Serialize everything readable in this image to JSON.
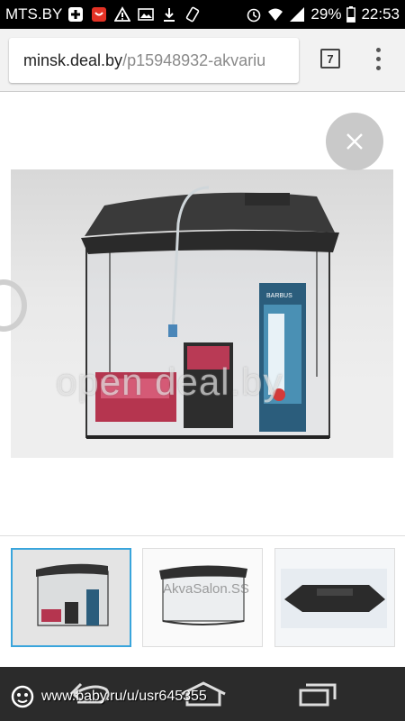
{
  "status_bar": {
    "carrier": "MTS.BY",
    "battery": "29%",
    "time": "22:53",
    "icons": [
      "plus-icon",
      "aliexpress-icon",
      "warning-icon",
      "image-icon",
      "download-icon",
      "vibrate-icon",
      "alarm-icon",
      "wifi-icon",
      "signal-icon",
      "battery-icon"
    ]
  },
  "browser": {
    "url_host": "minsk.deal.by",
    "url_path": "/p15948932-akvariu",
    "tab_count": "7"
  },
  "viewer": {
    "watermark": "open deal.by",
    "thumbnails": [
      {
        "selected": true,
        "watermark": ""
      },
      {
        "selected": false,
        "watermark": "AkvaSalon.SS"
      },
      {
        "selected": false,
        "watermark": ""
      }
    ]
  },
  "product_labels": {
    "heater_brand": "BARBUS"
  },
  "nav_bar": {
    "watermark_url": "www.baby.ru/u/usr645355"
  },
  "colors": {
    "status_bar": "#000000",
    "thumb_selected_border": "#39a5dc",
    "nav_bar": "#2b2b2b"
  }
}
